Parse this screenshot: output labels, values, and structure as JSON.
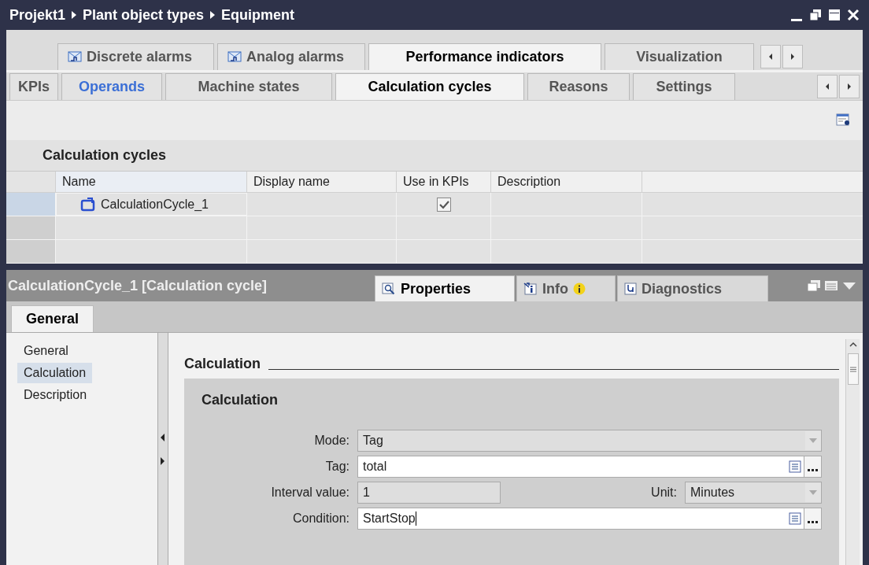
{
  "breadcrumb": [
    "Projekt1",
    "Plant object types",
    "Equipment"
  ],
  "editor_tabs": [
    {
      "label": "Discrete alarms",
      "selected": false
    },
    {
      "label": "Analog alarms",
      "selected": false
    },
    {
      "label": "Performance indicators",
      "selected": true
    },
    {
      "label": "Visualization",
      "selected": false
    }
  ],
  "sub_tabs": [
    {
      "label": "KPIs",
      "selected": false,
      "hovered": false
    },
    {
      "label": "Operands",
      "selected": false,
      "hovered": true
    },
    {
      "label": "Machine states",
      "selected": false,
      "hovered": false
    },
    {
      "label": "Calculation cycles",
      "selected": true,
      "hovered": false
    },
    {
      "label": "Reasons",
      "selected": false,
      "hovered": false
    },
    {
      "label": "Settings",
      "selected": false,
      "hovered": false
    }
  ],
  "table": {
    "title": "Calculation cycles",
    "columns": [
      "Name",
      "Display name",
      "Use in KPIs",
      "Description"
    ],
    "rows": [
      {
        "name": "CalculationCycle_1",
        "use_in_kpis": true,
        "selected": true
      }
    ]
  },
  "inspector": {
    "title": "CalculationCycle_1 [Calculation cycle]",
    "tabs": [
      {
        "label": "Properties",
        "selected": true
      },
      {
        "label": "Info",
        "badge": true,
        "selected": false
      },
      {
        "label": "Diagnostics",
        "selected": false
      }
    ],
    "page_tabs": [
      {
        "label": "General",
        "selected": true
      }
    ],
    "nav": [
      {
        "label": "General",
        "selected": false
      },
      {
        "label": "Calculation",
        "selected": true
      },
      {
        "label": "Description",
        "selected": false
      }
    ],
    "section": "Calculation",
    "group": "Calculation",
    "rows": [
      {
        "fields": [
          {
            "label": "Mode:",
            "value": "Tag",
            "kind": "dropdown",
            "disabled": true
          }
        ]
      },
      {
        "fields": [
          {
            "label": "Tag:",
            "value": "total",
            "kind": "browse",
            "disabled": false
          }
        ]
      },
      {
        "fields": [
          {
            "label": "Interval value:",
            "value": "1",
            "kind": "text",
            "disabled": true
          },
          {
            "label": "Unit:",
            "value": "Minutes",
            "kind": "dropdown",
            "disabled": true
          }
        ]
      },
      {
        "fields": [
          {
            "label": "Condition:",
            "value": "StartStop",
            "kind": "browse",
            "disabled": false,
            "focused": true
          }
        ]
      }
    ]
  }
}
